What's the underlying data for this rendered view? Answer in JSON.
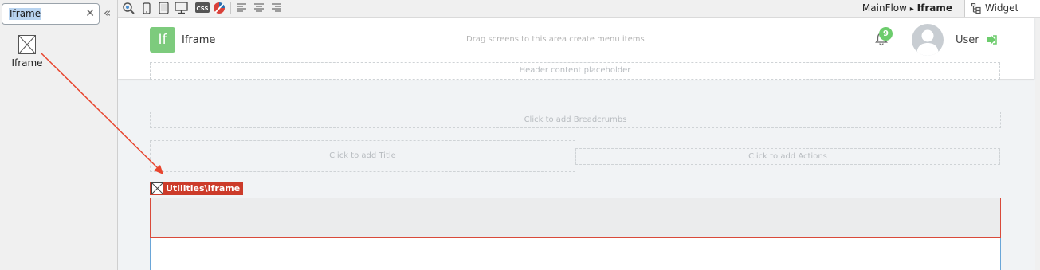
{
  "left_panel": {
    "search_value": "Iframe",
    "clear_icon": "close-icon",
    "collapse_icon": "double-chevron-left-icon",
    "widget_label": "Iframe"
  },
  "toolbar": {
    "icons": [
      "preview-icon",
      "phone-icon",
      "tablet-icon",
      "desktop-icon",
      "css-icon",
      "theme-icon",
      "align-left-icon",
      "align-center-icon",
      "align-right-icon"
    ],
    "breadcrumb_flow": "MainFlow",
    "breadcrumb_separator": "▸",
    "breadcrumb_screen": "Iframe",
    "widget_tree_label": "Widget Tree"
  },
  "header": {
    "logo_text": "If",
    "app_name": "Iframe",
    "menu_placeholder": "Drag screens to this area create menu items",
    "notification_count": "9",
    "user_name": "User",
    "header_placeholder": "Header content placeholder"
  },
  "content": {
    "breadcrumbs_placeholder": "Click to add Breadcrumbs",
    "title_placeholder": "Click to add Title",
    "actions_placeholder": "Click to add Actions",
    "widget_tag": "Utilities\\Iframe"
  },
  "colors": {
    "accent_green": "#7dcb7d",
    "badge_green": "#6ccc6c",
    "selection_red": "#cc3b2a",
    "arrow_red": "#e8452e"
  }
}
